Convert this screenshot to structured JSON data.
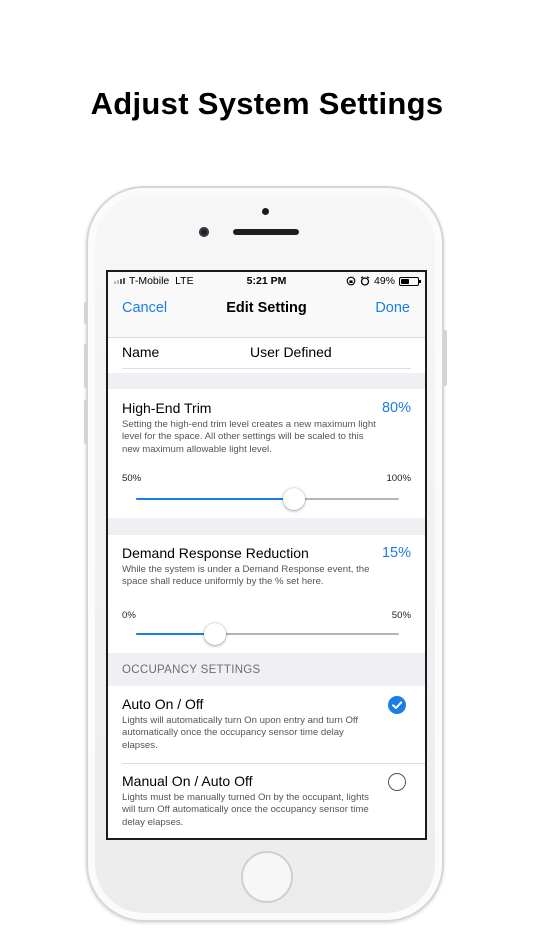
{
  "headline": "Adjust System Settings",
  "status_bar": {
    "carrier": "T-Mobile",
    "network": "LTE",
    "time": "5:21 PM",
    "battery": "49%",
    "battery_level": 0.49
  },
  "nav": {
    "cancel": "Cancel",
    "title": "Edit Setting",
    "done": "Done"
  },
  "name_row": {
    "label": "Name",
    "value": "User Defined"
  },
  "high_end_trim": {
    "label": "High-End Trim",
    "percent": "80%",
    "description": "Setting the high-end trim level creates a new maximum light level for the space. All other settings will be scaled to this new maximum allowable light level.",
    "min_label": "50%",
    "max_label": "100%",
    "slider_fraction": 0.6
  },
  "demand_response": {
    "label": "Demand Response Reduction",
    "percent": "15%",
    "description": "While the system is under a Demand Response event, the space shall reduce uniformly by the % set here.",
    "min_label": "0%",
    "max_label": "50%",
    "slider_fraction": 0.3
  },
  "occupancy": {
    "header": "OCCUPANCY SETTINGS",
    "options": [
      {
        "label": "Auto On / Off",
        "description": "Lights will automatically turn On upon entry and turn Off automatically once the occupancy sensor time delay elapses.",
        "selected": true
      },
      {
        "label": "Manual On / Auto Off",
        "description": "Lights must be manually turned On by the occupant, lights will turn Off automatically once the occupancy sensor time delay elapses.",
        "selected": false
      }
    ]
  },
  "colors": {
    "accent": "#1a7ee6",
    "grouped_background": "#efeff4"
  }
}
